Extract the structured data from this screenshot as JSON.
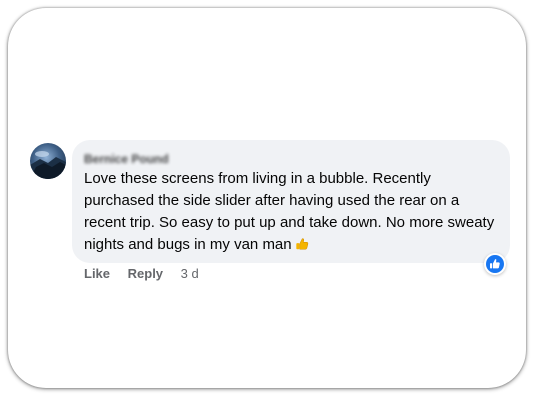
{
  "comment": {
    "author_name": "Bernice Pound",
    "text": "Love these screens from living in a bubble. Recently purchased the side slider after having used the rear on a recent trip. So easy to put up and take down. No more sweaty nights and bugs in my van man",
    "emoji_icon": "thumbs-up-emoji",
    "reaction_icon": "like-reaction-icon"
  },
  "actions": {
    "like_label": "Like",
    "reply_label": "Reply",
    "timestamp": "3 d"
  },
  "colors": {
    "bubble_bg": "#f0f2f5",
    "text": "#050505",
    "secondary_text": "#65676b",
    "like_blue": "#1877f2"
  }
}
